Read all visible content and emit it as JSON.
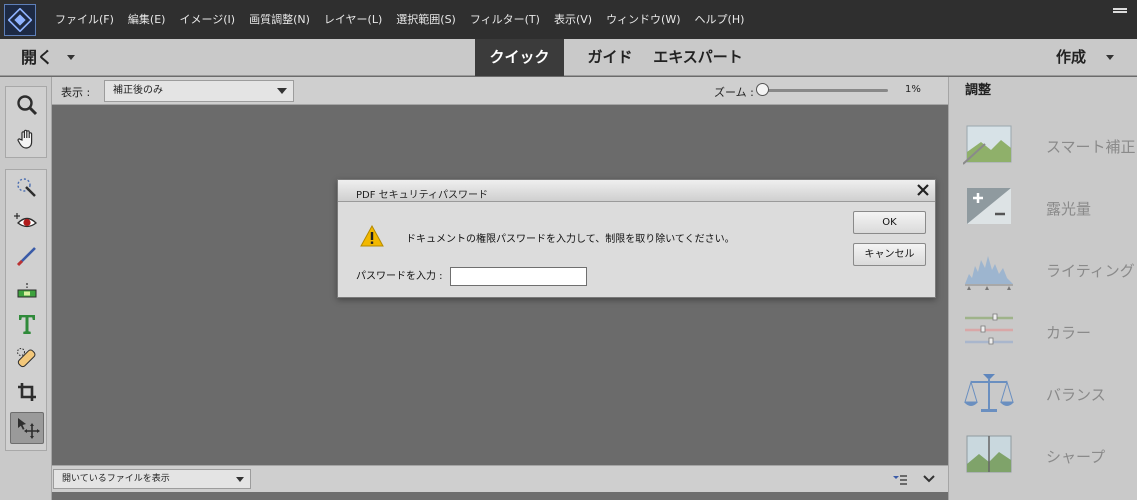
{
  "menubar": {
    "items": [
      "ファイル(F)",
      "編集(E)",
      "イメージ(I)",
      "画質調整(N)",
      "レイヤー(L)",
      "選択範囲(S)",
      "フィルター(T)",
      "表示(V)",
      "ウィンドウ(W)",
      "ヘルプ(H)"
    ]
  },
  "modebar": {
    "open_label": "開く",
    "tabs": [
      "クイック",
      "ガイド",
      "エキスパート"
    ],
    "active_tab": "クイック",
    "create_label": "作成"
  },
  "options": {
    "view_label": "表示 :",
    "view_value": "補正後のみ",
    "zoom_label": "ズーム :",
    "zoom_value": "1%",
    "zoom_level_percent": 1
  },
  "bottombar": {
    "file_select_value": "開いているファイルを表示"
  },
  "adjustments": {
    "title": "調整",
    "items": [
      {
        "label": "スマート補正",
        "icon": "smart-fix-icon"
      },
      {
        "label": "露光量",
        "icon": "exposure-icon"
      },
      {
        "label": "ライティング",
        "icon": "lighting-icon"
      },
      {
        "label": "カラー",
        "icon": "color-icon"
      },
      {
        "label": "バランス",
        "icon": "balance-icon"
      },
      {
        "label": "シャープ",
        "icon": "sharpen-icon"
      }
    ]
  },
  "tools": [
    "zoom-tool-icon",
    "hand-tool-icon",
    "quick-selection-icon",
    "red-eye-icon",
    "whiten-teeth-icon",
    "straighten-icon",
    "type-tool-icon",
    "spot-healing-icon",
    "crop-tool-icon",
    "move-tool-icon"
  ],
  "dialog": {
    "title": "PDF セキュリティパスワード",
    "message": "ドキュメントの権限パスワードを入力して、制限を取り除いてください。",
    "password_label": "パスワードを入力 :",
    "password_value": "",
    "ok_label": "OK",
    "cancel_label": "キャンセル"
  },
  "colors": {
    "menubar_bg": "#2f2f2f",
    "panel_bg": "#c9c9c9",
    "canvas_bg": "#6b6b6b",
    "active_tab_bg": "#3b3b3b",
    "warning": "#f2b800"
  }
}
